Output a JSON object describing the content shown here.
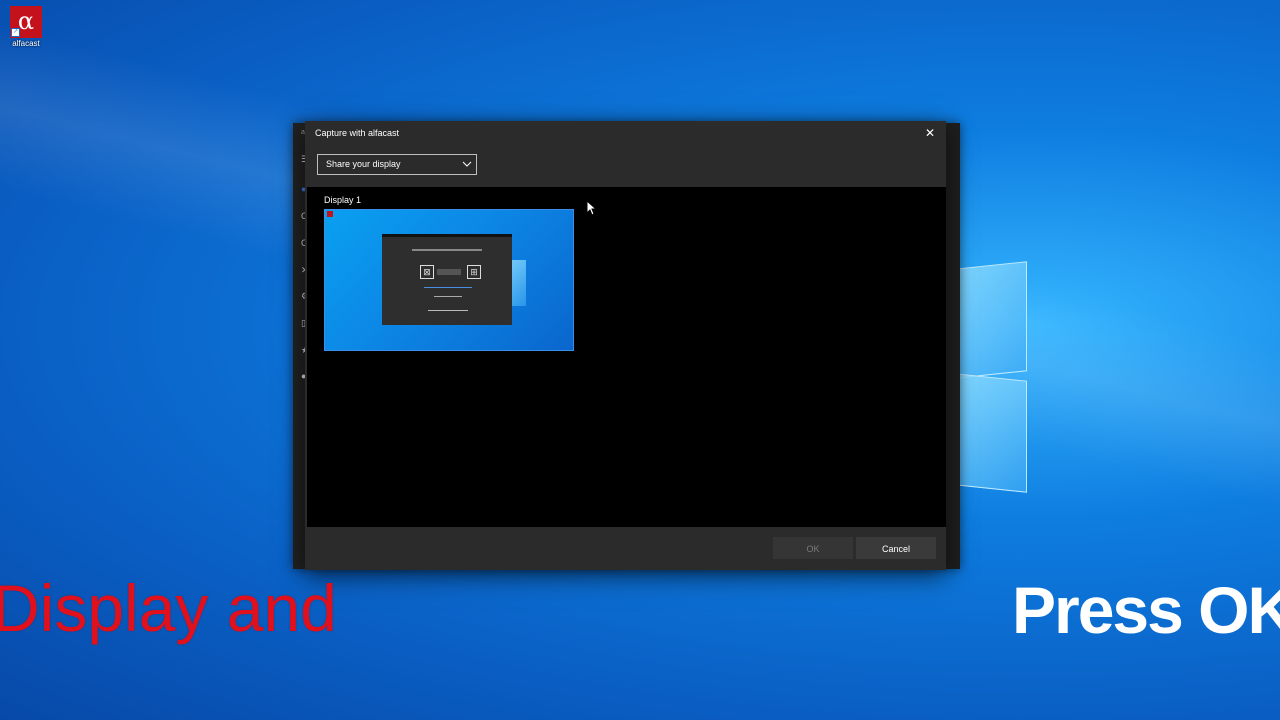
{
  "desktop": {
    "icon": {
      "glyph": "α",
      "label": "alfacast"
    }
  },
  "background_app": {
    "title_glyph": "a",
    "side_glyphs": [
      "☰",
      "●",
      "C",
      "C",
      "✕",
      "⚙",
      "▯",
      "★",
      "●"
    ]
  },
  "dialog": {
    "title": "Capture with alfacast",
    "close_glyph": "✕",
    "source_select": {
      "value": "Share your display"
    },
    "display": {
      "label": "Display 1"
    },
    "buttons": {
      "ok": "OK",
      "cancel": "Cancel"
    },
    "ok_enabled": false
  },
  "overlay": {
    "left_text": "Display and",
    "right_text": "Press OK"
  },
  "colors": {
    "brand_red": "#c4121c",
    "dialog_bg": "#2b2b2b",
    "overlay_red": "#e0101c"
  }
}
